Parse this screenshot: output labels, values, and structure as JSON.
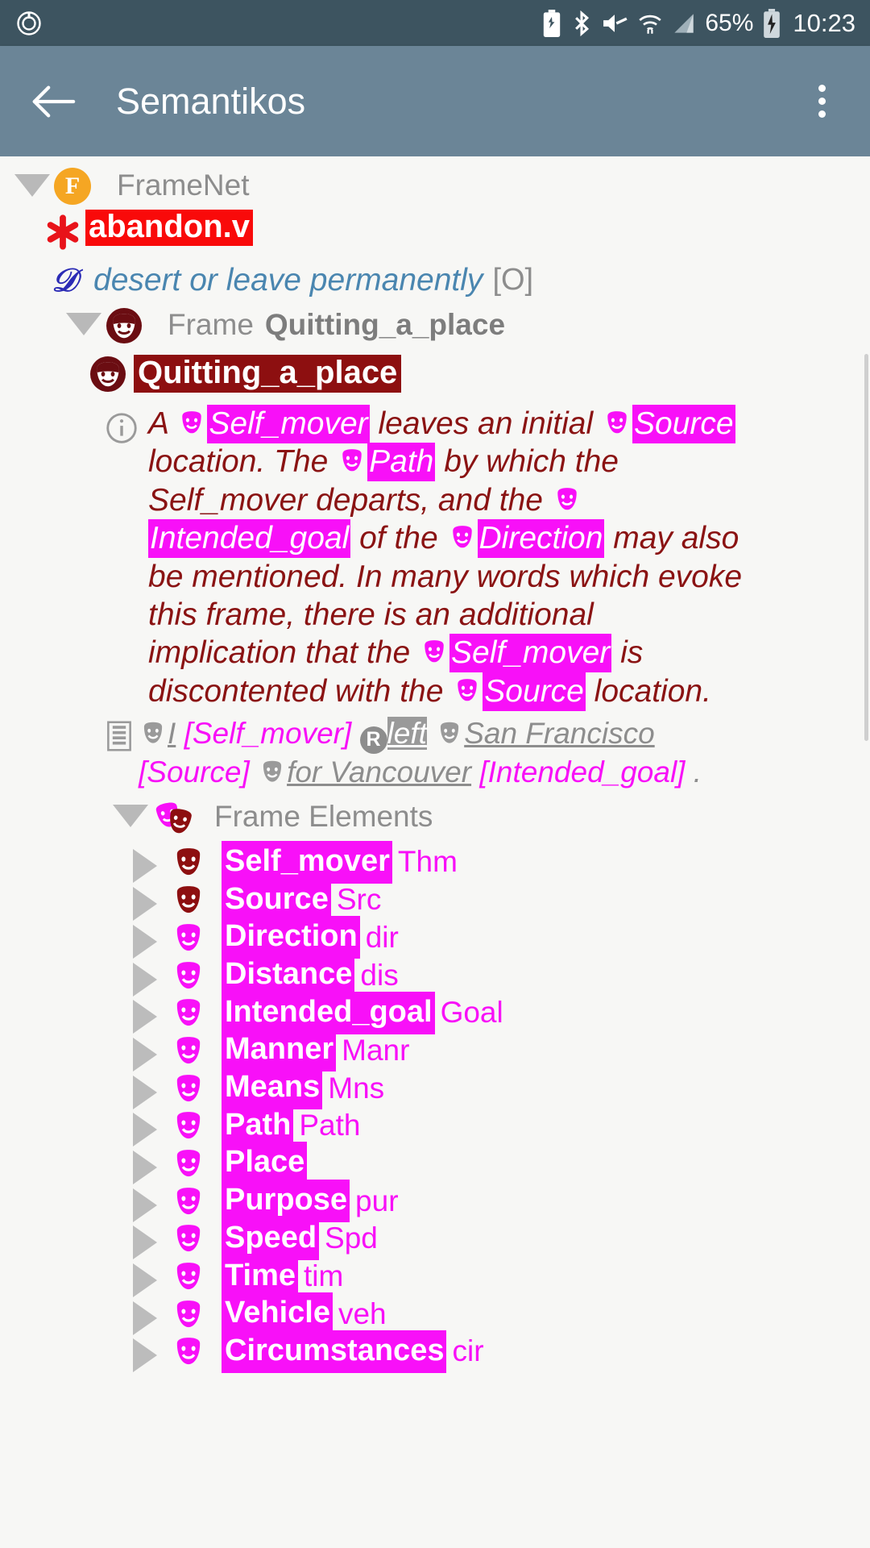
{
  "status_bar": {
    "icons": [
      "power-saving-icon",
      "bluetooth-icon",
      "mute-icon",
      "wifi-icon",
      "signal-icon"
    ],
    "battery_percent": "65%",
    "battery_icon": "battery-charging-icon",
    "clock": "10:23"
  },
  "app_bar": {
    "back_icon": "back-arrow-icon",
    "title": "Semantikos",
    "overflow_icon": "overflow-menu-icon"
  },
  "tree": {
    "root": {
      "icon": "framenet-badge-icon",
      "label": "FrameNet",
      "expanded": true
    },
    "lexical_unit": {
      "icon": "asterisk-icon",
      "label": "abandon.v",
      "highlight_color": "#f90a0a"
    },
    "lu_definition": {
      "icon": "dictionary-d-icon",
      "text": "desert or leave permanently",
      "tag": "[O]"
    },
    "frame_header": {
      "icon": "mask-dark-icon",
      "prefix": "Frame",
      "name": "Quitting_a_place",
      "expanded": true
    },
    "frame_title": {
      "icon": "mask-dark-icon",
      "label": "Quitting_a_place",
      "highlight_color": "#8d0f10"
    },
    "frame_definition": {
      "icon": "info-icon",
      "segments": [
        {
          "t": "A ",
          "k": "plain"
        },
        {
          "t": "Self_mover",
          "k": "fe"
        },
        {
          "t": " leaves an initial ",
          "k": "plain"
        },
        {
          "t": "Source",
          "k": "fe"
        },
        {
          "t": " location. The ",
          "k": "plain"
        },
        {
          "t": "Path",
          "k": "fe"
        },
        {
          "t": " by which the Self_mover departs, and the ",
          "k": "plain"
        },
        {
          "t": "Intended_goal",
          "k": "fe"
        },
        {
          "t": " of the ",
          "k": "plain"
        },
        {
          "t": "Direction",
          "k": "fe"
        },
        {
          "t": " may also be mentioned. In many words which evoke this frame, there is an additional implication that the ",
          "k": "plain"
        },
        {
          "t": "Self_mover",
          "k": "fe"
        },
        {
          "t": " is discontented with the ",
          "k": "plain"
        },
        {
          "t": "Source",
          "k": "fe"
        },
        {
          "t": " location.",
          "k": "plain"
        }
      ],
      "plain_text": "A Self_mover leaves an initial Source location. The Path by which the Self_mover departs, and the Intended_goal of the Direction may also be mentioned. In many words which evoke this frame, there is an additional implication that the Self_mover is discontented with the Source location."
    },
    "example_sentence": {
      "icon": "example-lines-icon",
      "full_text": "I [Self_mover] left San Francisco [Source] for Vancouver [Intended_goal].",
      "parts": [
        {
          "t": "I",
          "k": "ann"
        },
        {
          "t": "[Self_mover]",
          "k": "fe-tag"
        },
        {
          "t": "left",
          "k": "target"
        },
        {
          "t": "San Francisco",
          "k": "ann"
        },
        {
          "t": "[Source]",
          "k": "fe-tag"
        },
        {
          "t": "for Vancouver",
          "k": "ann"
        },
        {
          "t": "[Intended_goal]",
          "k": "fe-tag"
        },
        {
          "t": ".",
          "k": "plain"
        }
      ],
      "target_badge": "R"
    },
    "frame_elements_header": {
      "icon": "masks-pair-icon",
      "label": "Frame Elements",
      "expanded": true
    },
    "frame_elements": [
      {
        "name": "Self_mover",
        "abbr": "Thm",
        "core": true,
        "icon": "mask-dark-icon"
      },
      {
        "name": "Source",
        "abbr": "Src",
        "core": true,
        "icon": "mask-dark-icon"
      },
      {
        "name": "Direction",
        "abbr": "dir",
        "core": false,
        "icon": "mask-magenta-icon"
      },
      {
        "name": "Distance",
        "abbr": "dis",
        "core": false,
        "icon": "mask-magenta-icon"
      },
      {
        "name": "Intended_goal",
        "abbr": "Goal",
        "core": false,
        "icon": "mask-magenta-icon"
      },
      {
        "name": "Manner",
        "abbr": "Manr",
        "core": false,
        "icon": "mask-magenta-icon"
      },
      {
        "name": "Means",
        "abbr": "Mns",
        "core": false,
        "icon": "mask-magenta-icon"
      },
      {
        "name": "Path",
        "abbr": "Path",
        "core": false,
        "icon": "mask-magenta-icon"
      },
      {
        "name": "Place",
        "abbr": "",
        "core": false,
        "icon": "mask-magenta-icon"
      },
      {
        "name": "Purpose",
        "abbr": "pur",
        "core": false,
        "icon": "mask-magenta-icon"
      },
      {
        "name": "Speed",
        "abbr": "Spd",
        "core": false,
        "icon": "mask-magenta-icon"
      },
      {
        "name": "Time",
        "abbr": "tim",
        "core": false,
        "icon": "mask-magenta-icon"
      },
      {
        "name": "Vehicle",
        "abbr": "veh",
        "core": false,
        "icon": "mask-magenta-icon"
      },
      {
        "name": "Circumstances",
        "abbr": "cir",
        "core": false,
        "icon": "mask-magenta-icon"
      }
    ]
  },
  "colors": {
    "status_bar": "#3d5460",
    "app_bar": "#6b8597",
    "lu_highlight": "#f90a0a",
    "frame_highlight": "#8d0f10",
    "fe_highlight": "#f810f8",
    "definition_text": "#8a1313",
    "lu_definition_text": "#4a86b0",
    "background": "#f7f7f5"
  }
}
